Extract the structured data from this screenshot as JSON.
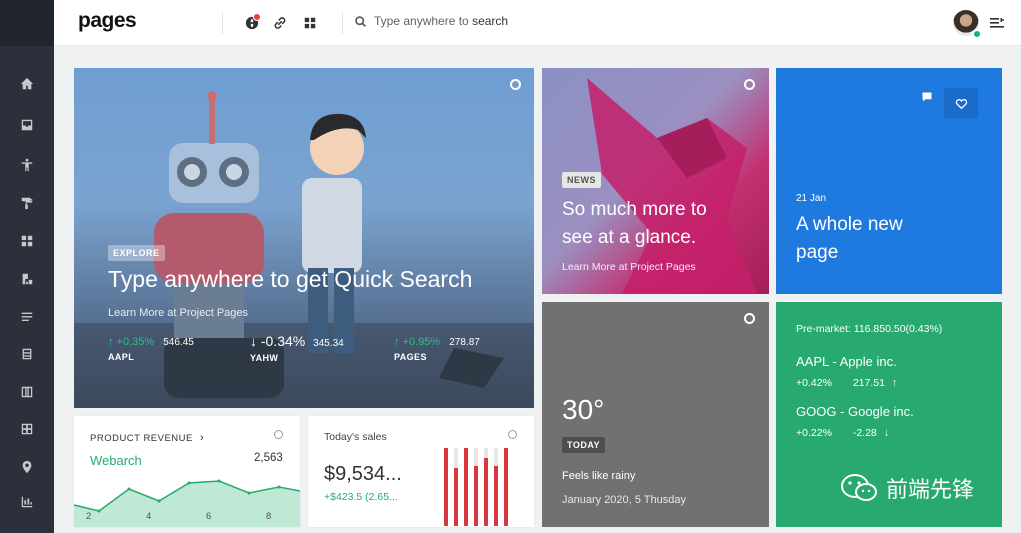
{
  "header": {
    "logo": "pages",
    "search_placeholder": "Type anywhere to ",
    "search_keyword": "search"
  },
  "sidebar": {
    "items": [
      "home-icon",
      "inbox-icon",
      "accessibility-icon",
      "paint-roller-icon",
      "widgets-icon",
      "charts-icon",
      "list-icon",
      "database-icon",
      "columns-icon",
      "table-icon",
      "map-pin-icon",
      "layout-icon"
    ]
  },
  "hero": {
    "badge": "EXPLORE",
    "title": "Type anywhere to get Quick Search",
    "link": "Learn More at Project Pages",
    "stocks": [
      {
        "change": "+0.35%",
        "price": "546.45",
        "name": "AAPL"
      },
      {
        "change": "-0.34%",
        "price": "345.34",
        "name": "YAHW"
      },
      {
        "change": "+0.95%",
        "price": "278.87",
        "name": "PAGES"
      }
    ]
  },
  "news": {
    "badge": "NEWS",
    "title_line1": "So much more to",
    "title_line2": "see at a glance.",
    "link": "Learn More at Project Pages"
  },
  "blue": {
    "date": "21 Jan",
    "title_line1": "A whole new",
    "title_line2": "page"
  },
  "weather": {
    "temp": "30°",
    "badge": "TODAY",
    "desc": "Feels like rainy",
    "date": "January 2020, 5 Thusday"
  },
  "market": {
    "premarket": "Pre-market: 116.850.50(0.43%)",
    "items": [
      {
        "name": "AAPL - Apple inc.",
        "change": "+0.42%",
        "value": "217.51"
      },
      {
        "name": "GOOG - Google inc.",
        "change": "+0.22%",
        "value": "-2.28"
      }
    ],
    "watermark": "前端先锋"
  },
  "revenue": {
    "title": "PRODUCT REVENUE",
    "name": "Webarch",
    "value": "2,563",
    "ticks": [
      "2",
      "4",
      "6",
      "8"
    ]
  },
  "sales": {
    "title": "Today's sales",
    "amount": "$9,534...",
    "delta": "+$423.5 (2.65..."
  },
  "colors": {
    "sidebar": "#2b303b",
    "blue": "#1f7ae0",
    "green": "#27a970",
    "red": "#d9363e"
  }
}
